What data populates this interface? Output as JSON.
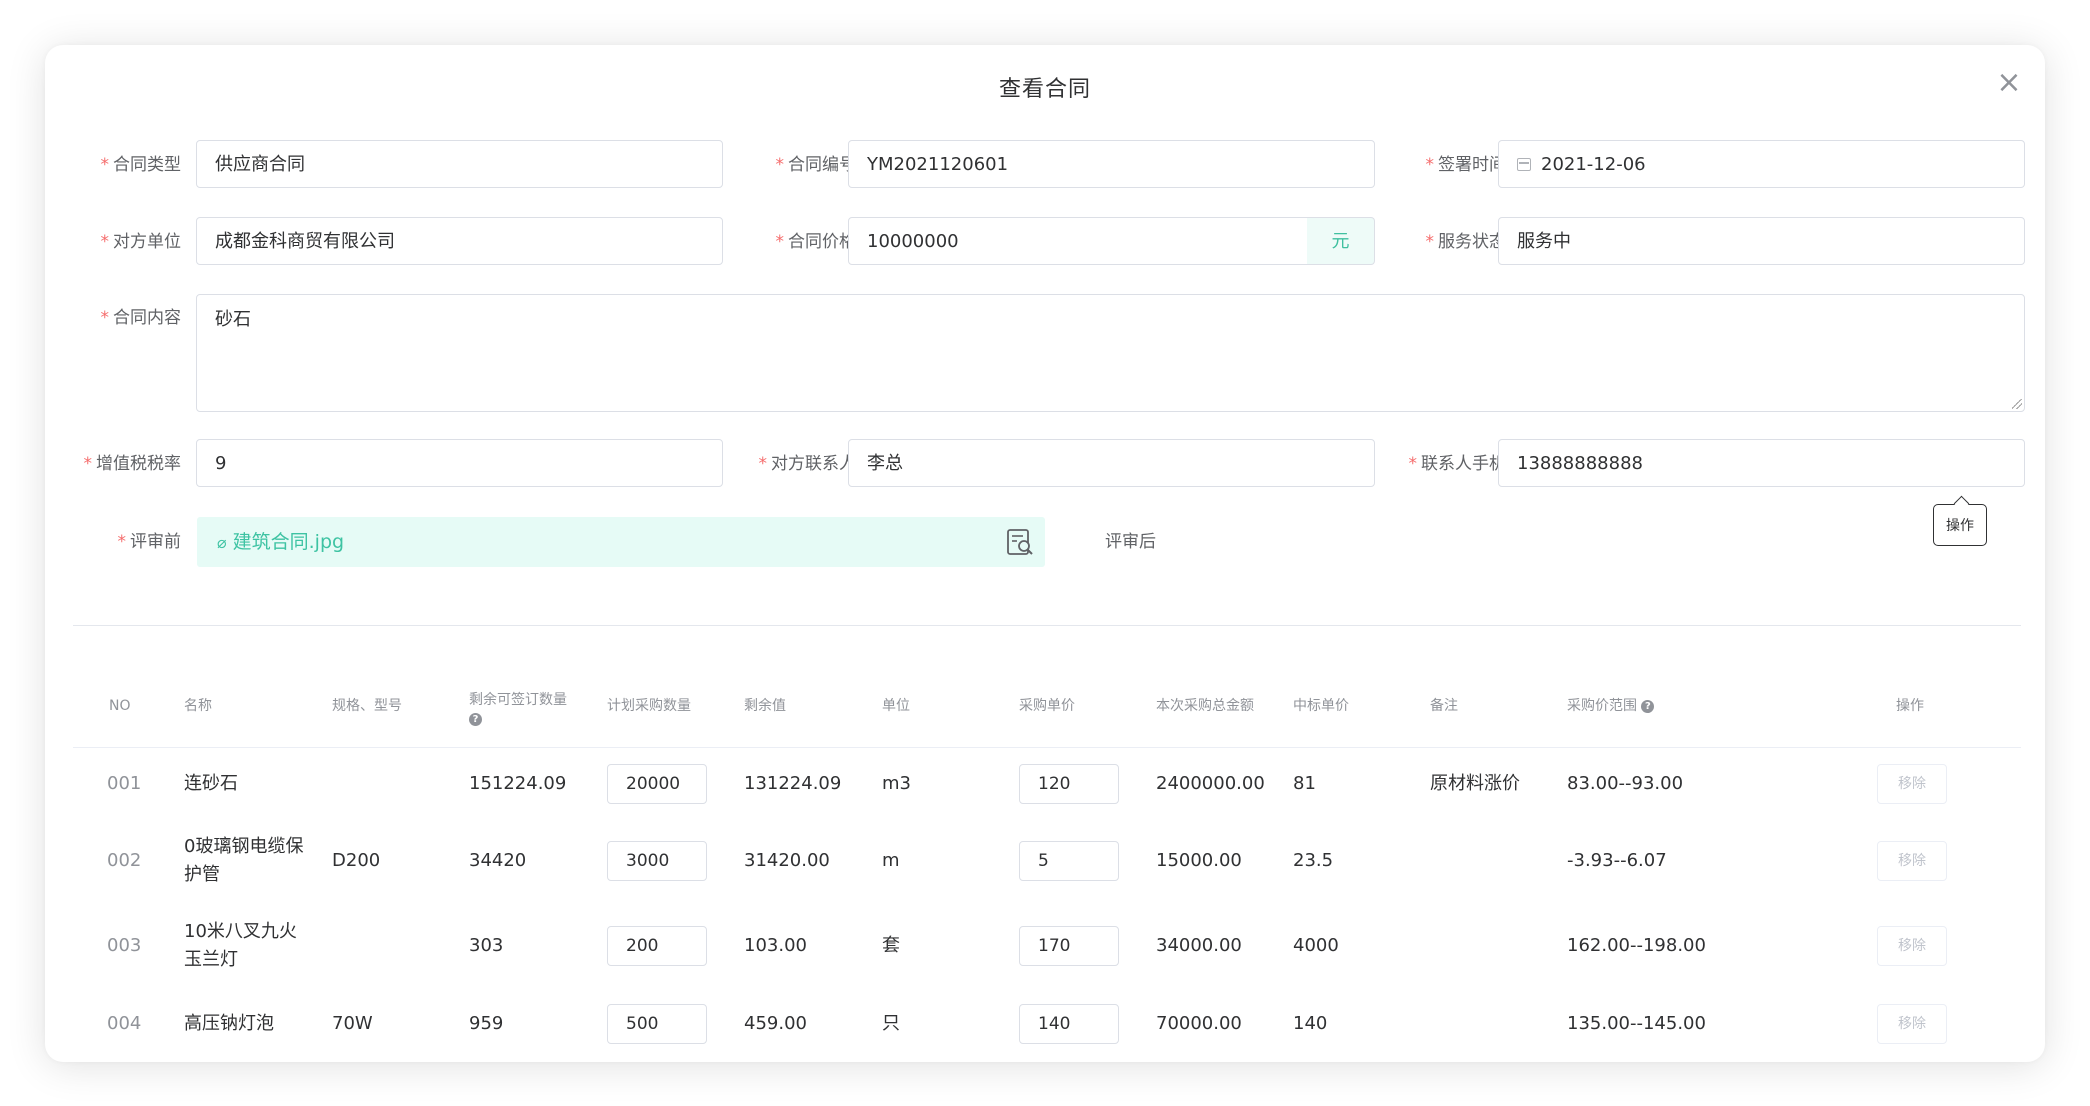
{
  "dialog": {
    "title": "查看合同",
    "close": "×"
  },
  "form": {
    "contract_type": {
      "label": "合同类型",
      "value": "供应商合同"
    },
    "contract_no": {
      "label": "合同编号",
      "value": "YM2021120601"
    },
    "sign_date": {
      "label": "签署时间",
      "value": "2021-12-06"
    },
    "counterparty": {
      "label": "对方单位",
      "value": "成都金科商贸有限公司"
    },
    "price": {
      "label": "合同价格",
      "value": "10000000",
      "unit": "元"
    },
    "service_status": {
      "label": "服务状态",
      "value": "服务中"
    },
    "content": {
      "label": "合同内容",
      "value": "砂石"
    },
    "vat_rate": {
      "label": "增值税税率",
      "value": "9"
    },
    "contact": {
      "label": "对方联系人",
      "value": "李总"
    },
    "phone": {
      "label": "联系人手机",
      "value": "13888888888"
    },
    "before_review": {
      "label": "评审前",
      "file": "建筑合同.jpg"
    },
    "after_review": {
      "label": "评审后"
    },
    "tooltip": "操作",
    "required_mark": "*"
  },
  "table": {
    "headers": {
      "no": "NO",
      "name": "名称",
      "spec": "规格、型号",
      "remaining_signable_1": "剩余可签订数量",
      "planned_qty": "计划采购数量",
      "remaining_value": "剩余值",
      "unit": "单位",
      "unit_price": "采购单价",
      "total_amount": "本次采购总金额",
      "bid_price": "中标单价",
      "remark": "备注",
      "price_range": "采购价范围",
      "action": "操作"
    },
    "rows": [
      {
        "no": "001",
        "name": "连砂石",
        "spec": "",
        "remaining": "151224.09",
        "planned": "20000",
        "remaining_value": "131224.09",
        "unit": "m3",
        "unit_price": "120",
        "total": "2400000.00",
        "bid_price": "81",
        "remark": "原材料涨价",
        "range": "83.00--93.00",
        "action": "移除"
      },
      {
        "no": "002",
        "name": "0玻璃钢电缆保护管",
        "spec": "D200",
        "remaining": "34420",
        "planned": "3000",
        "remaining_value": "31420.00",
        "unit": "m",
        "unit_price": "5",
        "total": "15000.00",
        "bid_price": "23.5",
        "remark": "",
        "range": "-3.93--6.07",
        "action": "移除"
      },
      {
        "no": "003",
        "name": "10米八叉九火玉兰灯",
        "spec": "",
        "remaining": "303",
        "planned": "200",
        "remaining_value": "103.00",
        "unit": "套",
        "unit_price": "170",
        "total": "34000.00",
        "bid_price": "4000",
        "remark": "",
        "range": "162.00--198.00",
        "action": "移除"
      },
      {
        "no": "004",
        "name": "高压钠灯泡",
        "spec": "70W",
        "remaining": "959",
        "planned": "500",
        "remaining_value": "459.00",
        "unit": "只",
        "unit_price": "140",
        "total": "70000.00",
        "bid_price": "140",
        "remark": "",
        "range": "135.00--145.00",
        "action": "移除"
      }
    ]
  },
  "colors": {
    "primary": "#3ec3a3",
    "required": "#f56c6c",
    "upload_bg": "#e6fbf6",
    "border": "#dcdfe6"
  },
  "icons": {
    "close": "close-icon",
    "calendar": "calendar-icon",
    "attachment": "paperclip-icon",
    "preview": "document-search-icon",
    "help": "question-circle-icon"
  }
}
